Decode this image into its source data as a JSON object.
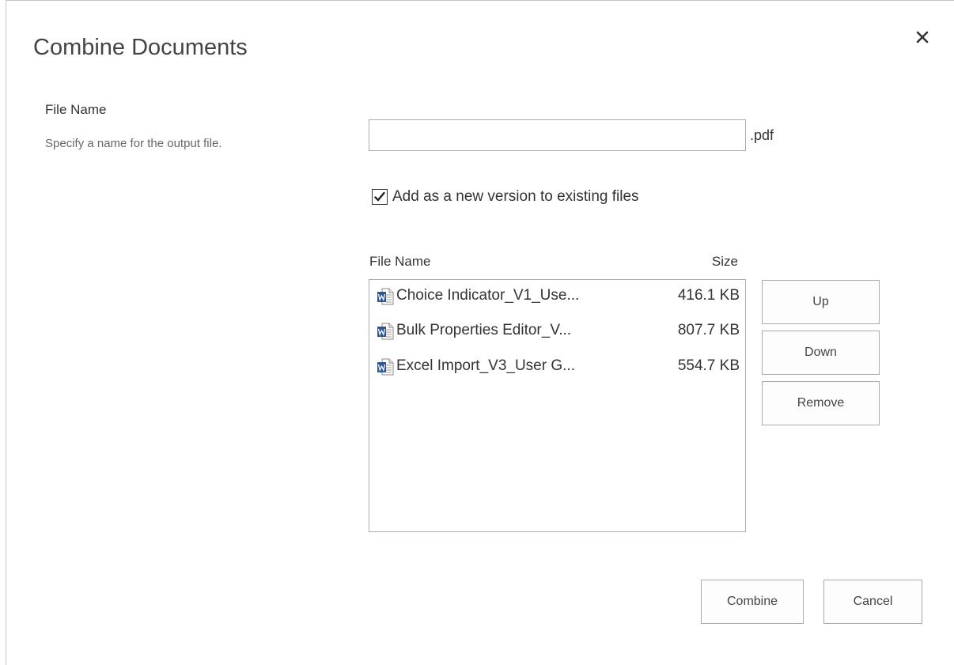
{
  "dialog": {
    "title": "Combine Documents",
    "close_icon": "close-icon"
  },
  "file_name_section": {
    "label": "File Name",
    "description": "Specify a name for the output file.",
    "input_value": "",
    "input_placeholder": "",
    "extension": ".pdf"
  },
  "version_option": {
    "label": "Add as a new version to existing files",
    "checked": true
  },
  "file_list": {
    "columns": {
      "name": "File Name",
      "size": "Size"
    },
    "icon": "word-document-icon",
    "items": [
      {
        "name": "Choice Indicator_V1_Use...",
        "size": "416.1 KB"
      },
      {
        "name": "Bulk Properties Editor_V...",
        "size": "807.7 KB"
      },
      {
        "name": "Excel Import_V3_User G...",
        "size": "554.7 KB"
      }
    ]
  },
  "list_buttons": {
    "up": "Up",
    "down": "Down",
    "remove": "Remove"
  },
  "actions": {
    "combine": "Combine",
    "cancel": "Cancel"
  },
  "colors": {
    "word_blue": "#2b5797",
    "border": "#ababab",
    "text": "#333333"
  }
}
